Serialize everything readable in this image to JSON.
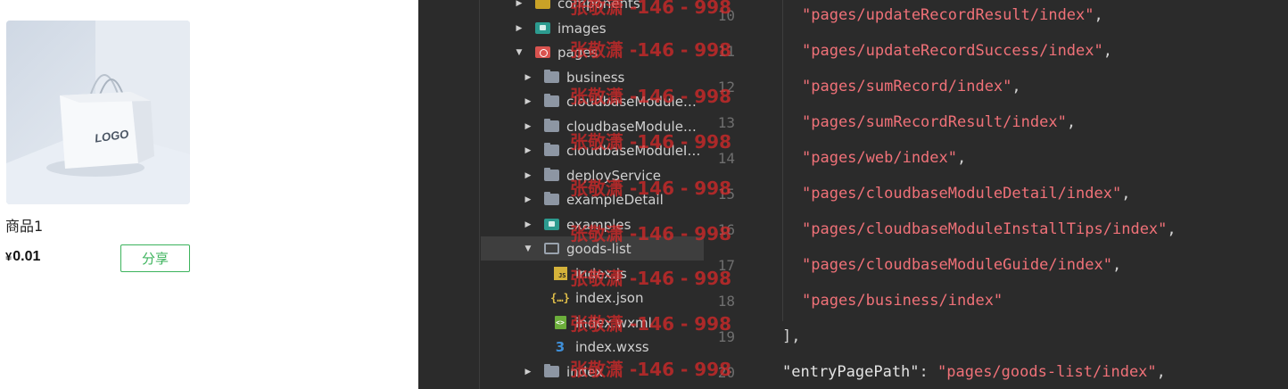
{
  "product": {
    "image_caption": "LOGO",
    "name": "商品1",
    "currency": "¥",
    "price": "0.01",
    "share_label": "分享"
  },
  "file_tree": {
    "items": [
      {
        "label": "components",
        "icon": "folder-yellow-icon",
        "arrow": "▶"
      },
      {
        "label": "images",
        "icon": "folder-teal-icon",
        "arrow": "▶"
      },
      {
        "label": "pages",
        "icon": "folder-red-icon",
        "arrow": "▼"
      },
      {
        "label": "business",
        "icon": "folder-icon",
        "arrow": "▶"
      },
      {
        "label": "cloudbaseModuleD...",
        "icon": "folder-icon",
        "arrow": "▶"
      },
      {
        "label": "cloudbaseModuleG...",
        "icon": "folder-icon",
        "arrow": "▶"
      },
      {
        "label": "cloudbaseModuleIn...",
        "icon": "folder-icon",
        "arrow": "▶"
      },
      {
        "label": "deployService",
        "icon": "folder-icon",
        "arrow": "▶"
      },
      {
        "label": "exampleDetail",
        "icon": "folder-icon",
        "arrow": "▶"
      },
      {
        "label": "examples",
        "icon": "folder-teal-icon",
        "arrow": "▶"
      },
      {
        "label": "goods-list",
        "icon": "folder-open-icon",
        "arrow": "▼"
      },
      {
        "label": "index.js",
        "icon": "js-file-icon",
        "arrow": ""
      },
      {
        "label": "index.json",
        "icon": "json-file-icon",
        "arrow": ""
      },
      {
        "label": "index.wxml",
        "icon": "wxml-file-icon",
        "arrow": ""
      },
      {
        "label": "index.wxss",
        "icon": "wxss-file-icon",
        "arrow": ""
      },
      {
        "label": "index",
        "icon": "folder-icon",
        "arrow": "▶"
      }
    ],
    "icon_glyphs": {
      "js": "JS",
      "json": "{…}",
      "wxml": "<>",
      "css": "3"
    }
  },
  "editor": {
    "line_numbers": [
      "10",
      "11",
      "12",
      "13",
      "14",
      "15",
      "16",
      "17",
      "18",
      "19",
      "20"
    ],
    "lines": [
      {
        "str": "\"pages/updateRecordResult/index\"",
        "tail": ","
      },
      {
        "str": "\"pages/updateRecordSuccess/index\"",
        "tail": ","
      },
      {
        "str": "\"pages/sumRecord/index\"",
        "tail": ","
      },
      {
        "str": "\"pages/sumRecordResult/index\"",
        "tail": ","
      },
      {
        "str": "\"pages/web/index\"",
        "tail": ","
      },
      {
        "str": "\"pages/cloudbaseModuleDetail/index\"",
        "tail": ","
      },
      {
        "str": "\"pages/cloudbaseModuleInstallTips/index\"",
        "tail": ","
      },
      {
        "str": "\"pages/cloudbaseModuleGuide/index\"",
        "tail": ","
      },
      {
        "str": "\"pages/business/index\"",
        "tail": ""
      },
      {
        "plain": "],"
      },
      {
        "key": "\"entryPagePath\"",
        "colon": ": ",
        "str": "\"pages/goods-list/index\"",
        "tail": ","
      }
    ]
  },
  "watermark": {
    "text": "张敬潇 -146 - 998"
  },
  "colors": {
    "accent_green": "#3cb35c",
    "string_red": "#f07178",
    "editor_bg": "#2b2b2b"
  }
}
